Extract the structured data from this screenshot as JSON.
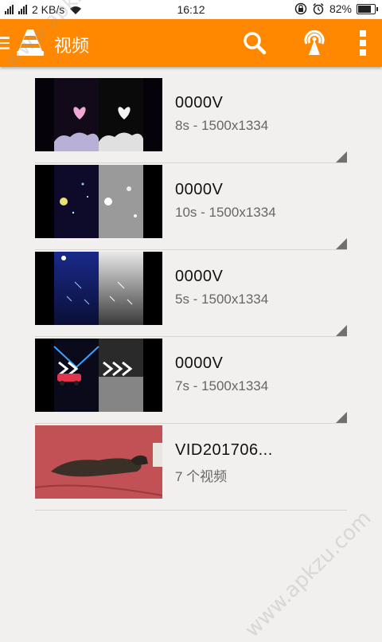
{
  "status_bar": {
    "network_speed": "2 KB/s",
    "time": "16:12",
    "battery_percent": "82%",
    "battery_level": 0.82
  },
  "appbar": {
    "title": "视频",
    "background": "#ff8800"
  },
  "videos": [
    {
      "title": "0000V",
      "subtitle": "8s - 1500x1334",
      "thumb": "hearts-clouds"
    },
    {
      "title": "0000V",
      "subtitle": "10s - 1500x1334",
      "thumb": "space-particles"
    },
    {
      "title": "0000V",
      "subtitle": "5s - 1500x1334",
      "thumb": "meteor-shower"
    },
    {
      "title": "0000V",
      "subtitle": "7s - 1500x1334",
      "thumb": "car-tunnel"
    },
    {
      "title": "VID201706...",
      "subtitle": "7 个视频",
      "thumb": "cat-on-carpet"
    }
  ],
  "watermark": "www.apkzu.com"
}
